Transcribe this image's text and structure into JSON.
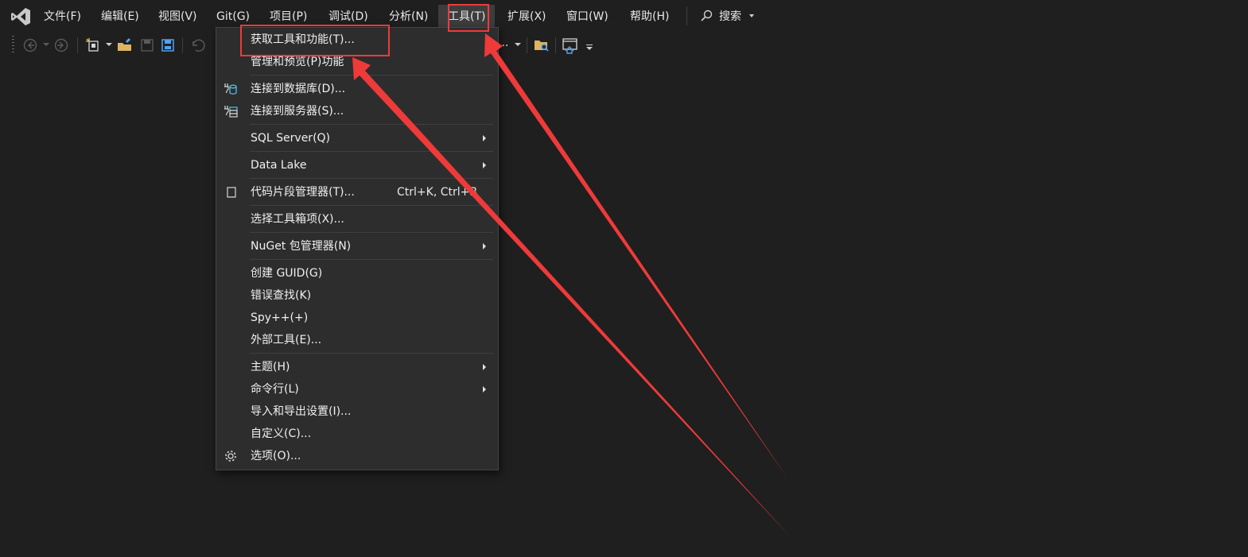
{
  "menubar": {
    "logo_icon": "visual-studio-logo-icon",
    "items": [
      "文件(F)",
      "编辑(E)",
      "视图(V)",
      "Git(G)",
      "项目(P)",
      "调试(D)",
      "分析(N)",
      "工具(T)",
      "扩展(X)",
      "窗口(W)",
      "帮助(H)"
    ],
    "active_item": "工具(T)",
    "search_label": "搜索",
    "search_icon": "search-icon"
  },
  "toolbar": {
    "truncated_text": "...",
    "icons": [
      "back-icon",
      "forward-icon",
      "new-project-icon",
      "open-file-icon",
      "save-icon",
      "save-all-icon",
      "undo-icon",
      "folder-search-icon",
      "home-window-icon"
    ]
  },
  "tools_menu": {
    "items": [
      {
        "label": "获取工具和功能(T)..."
      },
      {
        "label": "管理和预览(P)功能"
      },
      {
        "label": "连接到数据库(D)...",
        "icon": "database-connect-icon"
      },
      {
        "label": "连接到服务器(S)...",
        "icon": "server-connect-icon"
      },
      {
        "label": "SQL Server(Q)",
        "submenu": true
      },
      {
        "label": "Data Lake",
        "submenu": true
      },
      {
        "label": "代码片段管理器(T)...",
        "shortcut": "Ctrl+K, Ctrl+B",
        "icon": "snippet-manager-icon"
      },
      {
        "label": "选择工具箱项(X)..."
      },
      {
        "label": "NuGet 包管理器(N)",
        "submenu": true
      },
      {
        "label": "创建 GUID(G)"
      },
      {
        "label": "错误查找(K)"
      },
      {
        "label": "Spy++(+)"
      },
      {
        "label": "外部工具(E)..."
      },
      {
        "label": "主题(H)",
        "submenu": true
      },
      {
        "label": "命令行(L)",
        "submenu": true
      },
      {
        "label": "导入和导出设置(I)..."
      },
      {
        "label": "自定义(C)..."
      },
      {
        "label": "选项(O)...",
        "icon": "gear-icon"
      }
    ]
  },
  "annotations": {
    "color": "#ef3a3a"
  }
}
